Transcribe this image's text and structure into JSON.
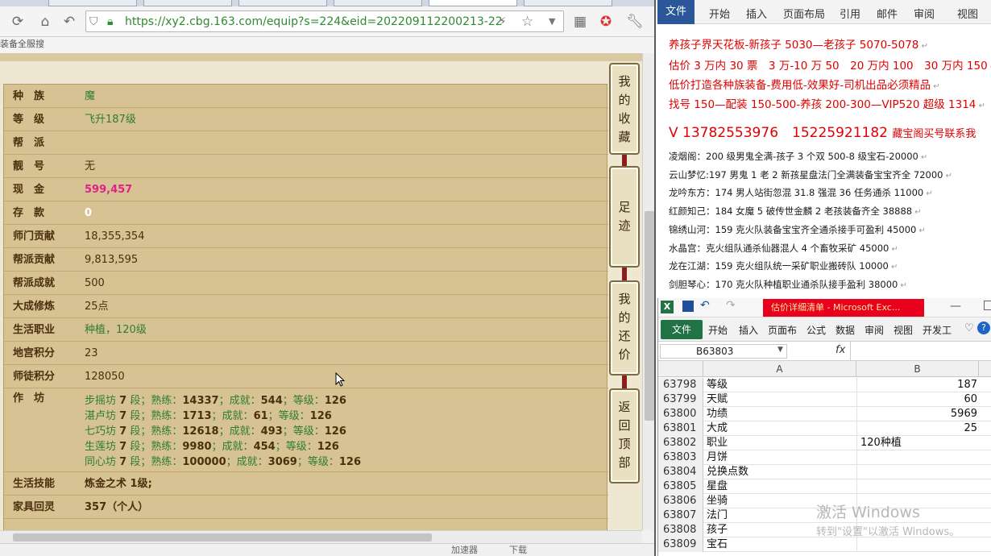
{
  "browser": {
    "url": "https://xy2.cbg.163.com/equip?s=224&eid=202209112200213-224-",
    "bookmark": "装备全服搜",
    "status_left": "加速器",
    "status_right": "下载"
  },
  "character": {
    "rows": [
      {
        "label": "种　族",
        "value": "魔",
        "style": "green"
      },
      {
        "label": "等　级",
        "value": "飞升187级",
        "style": "green"
      },
      {
        "label": "帮　派",
        "value": "",
        "style": ""
      },
      {
        "label": "靓　号",
        "value": "无",
        "style": ""
      },
      {
        "label": "现　金",
        "value": "599,457",
        "style": "pink"
      },
      {
        "label": "存　款",
        "value": "0",
        "style": "white"
      },
      {
        "label": "师门贡献",
        "value": "18,355,354",
        "style": ""
      },
      {
        "label": "帮派贡献",
        "value": "9,813,595",
        "style": ""
      },
      {
        "label": "帮派成就",
        "value": "500",
        "style": ""
      },
      {
        "label": "大成修炼",
        "value": "25点",
        "style": ""
      },
      {
        "label": "生活职业",
        "value": "种植，120级",
        "style": "green"
      },
      {
        "label": "地宫积分",
        "value": "23",
        "style": ""
      },
      {
        "label": "师徒积分",
        "value": "128050",
        "style": ""
      }
    ],
    "workshop_label": "作　坊",
    "workshops": [
      {
        "name": "步摇坊",
        "level": "7",
        "skill": "14337",
        "achieve": "544",
        "grade": "126"
      },
      {
        "name": "湛卢坊",
        "level": "7",
        "skill": "1713",
        "achieve": "61",
        "grade": "126"
      },
      {
        "name": "七巧坊",
        "level": "7",
        "skill": "12618",
        "achieve": "493",
        "grade": "126"
      },
      {
        "name": "生莲坊",
        "level": "7",
        "skill": "9980",
        "achieve": "454",
        "grade": "126"
      },
      {
        "name": "同心坊",
        "level": "7",
        "skill": "100000",
        "achieve": "3069",
        "grade": "126"
      }
    ],
    "ws_words": {
      "duan": "段；熟练：",
      "achieve": "；成就：",
      "grade": "；等级："
    },
    "life_skill_label": "生活技能",
    "life_skill_value": "炼金之术 1级;",
    "furniture_label": "家具回灵",
    "furniture_value": "357（个人）"
  },
  "side_buttons": [
    {
      "text": "我的收藏"
    },
    {
      "text": "足迹"
    },
    {
      "text": "我的还价"
    },
    {
      "text": "返回顶部"
    }
  ],
  "word": {
    "tabs": [
      "文件",
      "开始",
      "插入",
      "页面布局",
      "引用",
      "邮件",
      "审阅",
      "视图"
    ],
    "lines_red": [
      "养孩子界天花板-新孩子 5030—老孩子 5070-5078",
      "估价 3 万内 30 票　3 万-10 万 50　20 万内 100　30 万内 150",
      "低价打造各种族装备-费用低-效果好-司机出品必须精品",
      "找号 150—配装 150-500-养孩 200-300—VIP520 超级 1314"
    ],
    "phone_line": "V 13782553976　15225921182",
    "phone_suffix": "藏宝阁买号联系我",
    "lines_small": [
      "凌烟阁：200 级男鬼全满-孩子 3 个双 500-8 级宝石-20000",
      "云山梦忆:197 男鬼 1 老 2 新孩星盘法门全满装备宝宝齐全 72000",
      "龙吟东方：174 男人站街忽混 31.8 强混 36 任务通杀 11000",
      "红颜知己：184 女魔 5 破传世金麟 2 老孩装备齐全 38888",
      "锦绣山河：159 克火队装备宝宝齐全通杀接手可盈利 45000",
      "水晶宫：克火组队通杀仙器混人 4 个畜牧采矿 45000",
      "龙在江湖：159 克火组队统一采矿职业搬砖队 10000",
      "剑胆琴心：170 克火队种植职业通杀队接手盈利 38000"
    ]
  },
  "excel": {
    "title": "估价详细清单 - Microsoft Exc...",
    "tabs": [
      "开始",
      "插入",
      "页面布",
      "公式",
      "数据",
      "审阅",
      "视图",
      "开发工"
    ],
    "file_label": "文件",
    "name_box": "B63803",
    "fx": "fx",
    "col_a": "A",
    "col_b": "B",
    "rows": [
      {
        "n": "63798",
        "a": "等级",
        "b": "187"
      },
      {
        "n": "63799",
        "a": "天赋",
        "b": "60"
      },
      {
        "n": "63800",
        "a": "功绩",
        "b": "5969"
      },
      {
        "n": "63801",
        "a": "大成",
        "b": "25"
      },
      {
        "n": "63802",
        "a": "职业",
        "b": "120种植",
        "left": true
      },
      {
        "n": "63803",
        "a": "月饼",
        "b": ""
      },
      {
        "n": "63804",
        "a": "兑换点数",
        "b": ""
      },
      {
        "n": "63805",
        "a": "星盘",
        "b": ""
      },
      {
        "n": "63806",
        "a": "坐骑",
        "b": ""
      },
      {
        "n": "63807",
        "a": "法门",
        "b": ""
      },
      {
        "n": "63808",
        "a": "孩子",
        "b": ""
      },
      {
        "n": "63809",
        "a": "宝石",
        "b": ""
      }
    ],
    "watermark_title": "激活 Windows",
    "watermark_sub": "转到\"设置\"以激活 Windows。"
  },
  "colors": {
    "panel": "#d7c293",
    "label": "#4a2f0c",
    "green": "#2e7d32",
    "pink": "#e0218a",
    "word_red": "#e00000",
    "excel_green": "#217346",
    "excel_title_red": "#e8001c"
  }
}
